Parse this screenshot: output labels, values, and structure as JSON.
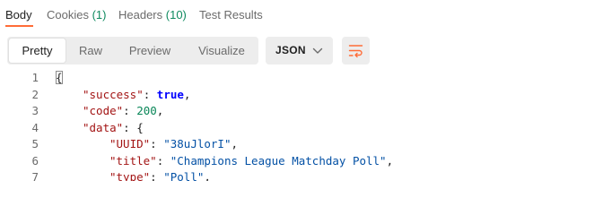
{
  "tabs": [
    {
      "label": "Body",
      "count": ""
    },
    {
      "label": "Cookies",
      "count": "(1)"
    },
    {
      "label": "Headers",
      "count": "(10)"
    },
    {
      "label": "Test Results",
      "count": ""
    }
  ],
  "format_buttons": [
    "Pretty",
    "Raw",
    "Preview",
    "Visualize"
  ],
  "active_format": "Pretty",
  "language": "JSON",
  "icons": {
    "dropdown": "chevron-down-icon",
    "wrap": "wrap-lines-icon"
  },
  "colors": {
    "accent": "#ff6c37",
    "count": "#0f8a5f",
    "json_key": "#a31515",
    "json_string": "#0451a5",
    "json_number": "#098658",
    "json_boolean": "#0000ff"
  },
  "code_lines": [
    {
      "num": "1",
      "parts": [
        {
          "t": "p",
          "v": "{"
        }
      ]
    },
    {
      "num": "2",
      "parts": [
        {
          "t": "k",
          "v": "\"success\""
        },
        {
          "t": "p",
          "v": ": "
        },
        {
          "t": "b",
          "v": "true"
        },
        {
          "t": "p",
          "v": ","
        }
      ]
    },
    {
      "num": "3",
      "parts": [
        {
          "t": "k",
          "v": "\"code\""
        },
        {
          "t": "p",
          "v": ": "
        },
        {
          "t": "n",
          "v": "200"
        },
        {
          "t": "p",
          "v": ","
        }
      ]
    },
    {
      "num": "4",
      "parts": [
        {
          "t": "k",
          "v": "\"data\""
        },
        {
          "t": "p",
          "v": ": {"
        }
      ]
    },
    {
      "num": "5",
      "parts": [
        {
          "t": "k",
          "v": "\"UUID\""
        },
        {
          "t": "p",
          "v": ": "
        },
        {
          "t": "s",
          "v": "\"38uJlorI\""
        },
        {
          "t": "p",
          "v": ","
        }
      ]
    },
    {
      "num": "6",
      "parts": [
        {
          "t": "k",
          "v": "\"title\""
        },
        {
          "t": "p",
          "v": ": "
        },
        {
          "t": "s",
          "v": "\"Champions League Matchday Poll\""
        },
        {
          "t": "p",
          "v": ","
        }
      ]
    },
    {
      "num": "7",
      "parts": [
        {
          "t": "k",
          "v": "\"type\""
        },
        {
          "t": "p",
          "v": ": "
        },
        {
          "t": "s",
          "v": "\"Poll\""
        },
        {
          "t": "p",
          "v": ","
        }
      ]
    }
  ]
}
